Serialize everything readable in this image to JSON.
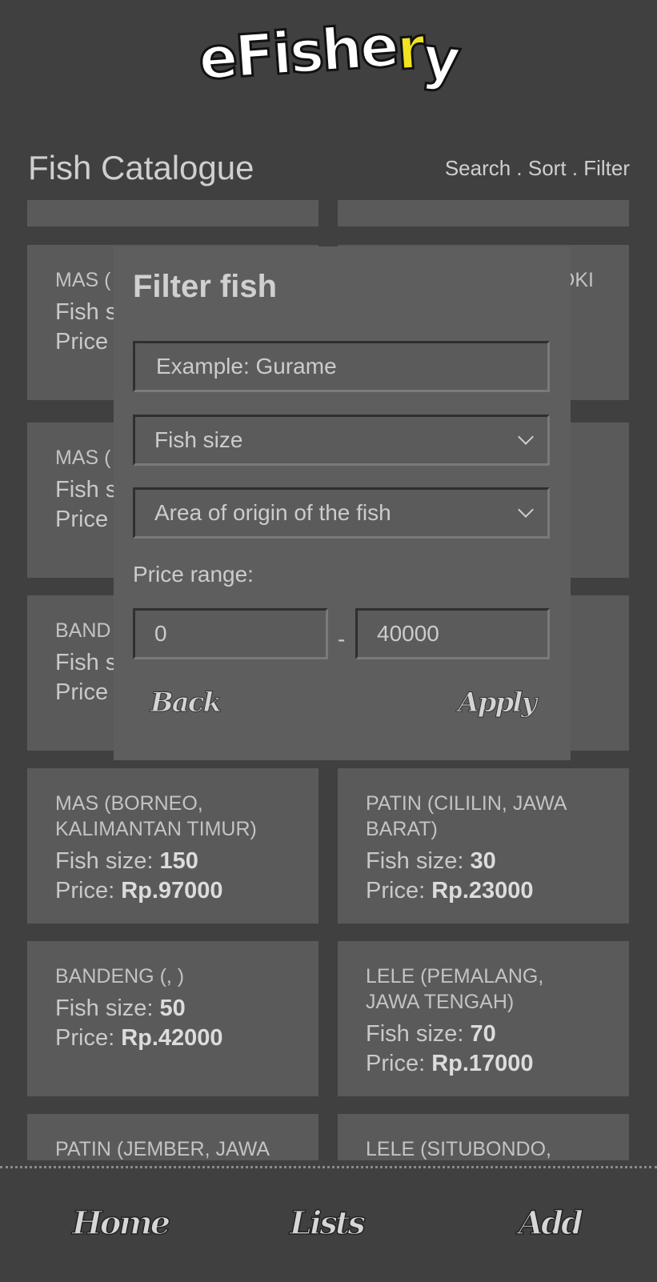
{
  "app": {
    "logo": {
      "main": "eFishe",
      "accent": "r",
      "tail": "y"
    },
    "title": "Fish Catalogue",
    "actions": "Search . Sort . Filter"
  },
  "cards": [
    {
      "name": "MAS ( JAWA",
      "size_label": "Fish s",
      "size": "",
      "price_label": "Price",
      "price": ""
    },
    {
      "name": "",
      "size_label": "",
      "size": "",
      "price_label": "",
      "price": "",
      "right_fragment": "OKI"
    },
    {
      "name": "MAS ( JAWA",
      "size_label": "Fish s",
      "size": "",
      "price_label": "Price",
      "price": ""
    },
    {
      "name": "",
      "size_label": "",
      "size": "",
      "price_label": "",
      "price": ""
    },
    {
      "name": "BAND JAWA",
      "size_label": "Fish s",
      "size": "",
      "price_label": "Price",
      "price": ""
    },
    {
      "name": "",
      "size_label": "",
      "size": "",
      "price_label": "",
      "price": ""
    },
    {
      "name": "MAS (BORNEO, KALIMANTAN TIMUR)",
      "size_label": "Fish size: ",
      "size": "150",
      "price_label": "Price: ",
      "price": "Rp.97000"
    },
    {
      "name": "PATIN (CILILIN, JAWA BARAT)",
      "size_label": "Fish size: ",
      "size": "30",
      "price_label": "Price: ",
      "price": "Rp.23000"
    },
    {
      "name": "BANDENG (, )",
      "size_label": "Fish size: ",
      "size": "50",
      "price_label": "Price: ",
      "price": "Rp.42000"
    },
    {
      "name": "LELE (PEMALANG, JAWA TENGAH)",
      "size_label": "Fish size: ",
      "size": "70",
      "price_label": "Price: ",
      "price": "Rp.17000"
    },
    {
      "name": "PATIN (JEMBER, JAWA",
      "size_label": "",
      "size": "",
      "price_label": "",
      "price": ""
    },
    {
      "name": "LELE (SITUBONDO,",
      "size_label": "",
      "size": "",
      "price_label": "",
      "price": ""
    }
  ],
  "filter": {
    "title": "Filter fish",
    "search_placeholder": "Example: Gurame",
    "size_select": "Fish size",
    "area_select": "Area of origin of the fish",
    "price_label": "Price range:",
    "price_min": "0",
    "price_separator": "-",
    "price_max": "40000",
    "back": "Back",
    "apply": "Apply"
  },
  "nav": {
    "home": "Home",
    "lists": "Lists",
    "add": "Add"
  }
}
